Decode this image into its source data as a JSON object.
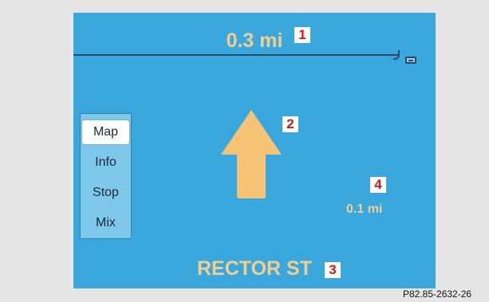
{
  "top_distance": "0.3 mi",
  "menu": {
    "items": [
      {
        "label": "Map",
        "selected": true
      },
      {
        "label": "Info",
        "selected": false
      },
      {
        "label": "Stop",
        "selected": false
      },
      {
        "label": "Mix",
        "selected": false
      }
    ]
  },
  "direction": "straight-arrow-icon",
  "side_distance": "0.1 mi",
  "street_name": "RECTOR ST",
  "callouts": [
    "1",
    "2",
    "3",
    "4"
  ],
  "figure_code": "P82.85-2632-26",
  "colors": {
    "screen_background": "#3aa7dd",
    "text_highlight": "#f2cf8f",
    "callout_text": "#d11a1a"
  }
}
